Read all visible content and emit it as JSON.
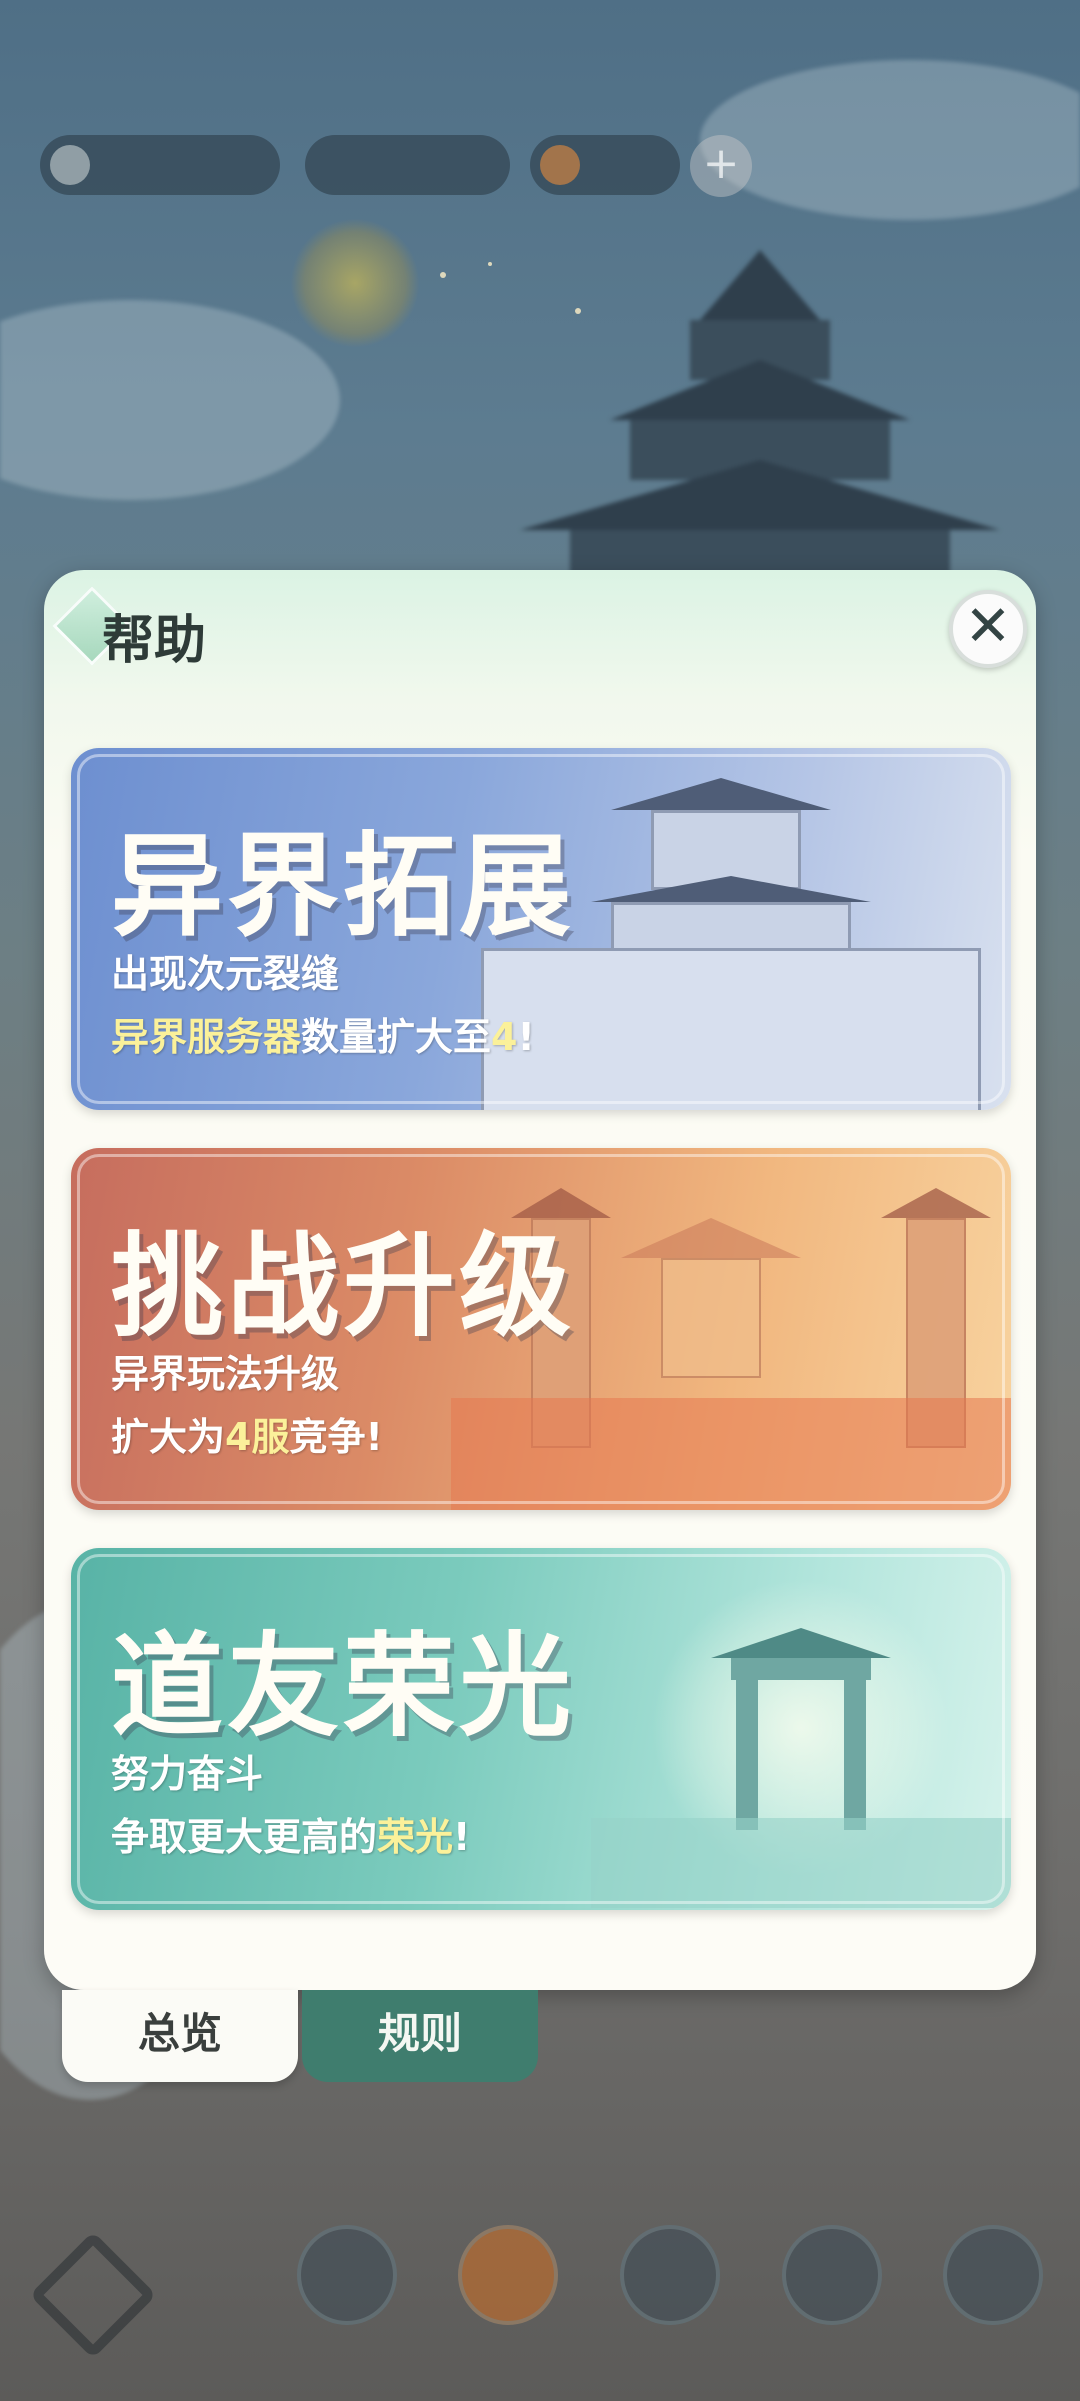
{
  "background": {
    "hud_items": [
      "",
      "",
      ""
    ],
    "event_label": "",
    "bottom_nav": [
      "",
      "",
      "",
      "",
      ""
    ]
  },
  "modal": {
    "title": "帮助",
    "close_icon": "close-icon"
  },
  "cards": [
    {
      "heading": "异界拓展",
      "line1": [
        {
          "text": "出现次元裂缝",
          "highlight": false
        }
      ],
      "line2": [
        {
          "text": "异界服务器",
          "highlight": true
        },
        {
          "text": "数量扩大至",
          "highlight": false
        },
        {
          "text": "4",
          "highlight": true
        },
        {
          "text": "!",
          "highlight": false
        }
      ]
    },
    {
      "heading": "挑战升级",
      "line1": [
        {
          "text": "异界玩法升级",
          "highlight": false
        }
      ],
      "line2": [
        {
          "text": "扩大为",
          "highlight": false
        },
        {
          "text": "4服",
          "highlight": true
        },
        {
          "text": "竞争!",
          "highlight": false
        }
      ]
    },
    {
      "heading": "道友荣光",
      "line1": [
        {
          "text": "努力奋斗",
          "highlight": false
        }
      ],
      "line2": [
        {
          "text": "争取更大更高的",
          "highlight": false
        },
        {
          "text": "荣光",
          "highlight": true
        },
        {
          "text": "!",
          "highlight": false
        }
      ]
    }
  ],
  "tabs": {
    "overview": "总览",
    "rules": "规则",
    "selected": "overview"
  },
  "colors": {
    "highlight": "#fbf19a",
    "tab_active": "#fbfbf6",
    "tab_inactive": "#3f7d6e"
  }
}
